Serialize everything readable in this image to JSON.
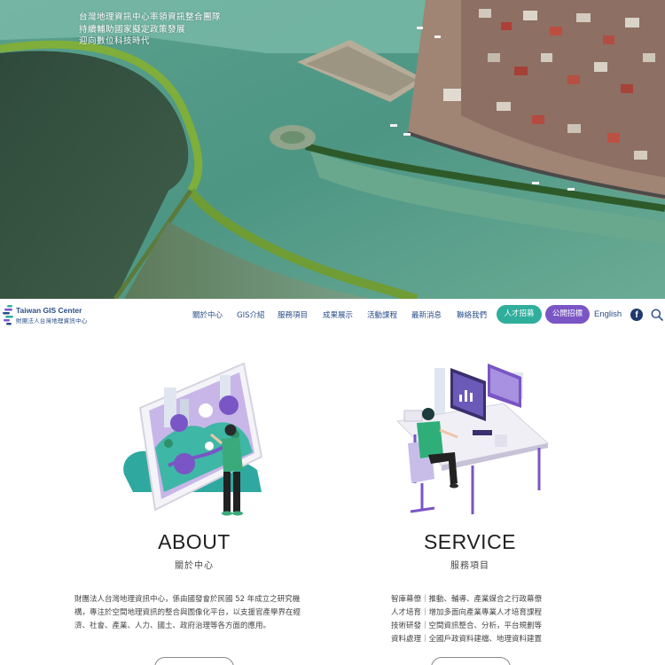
{
  "hero": {
    "lines": [
      "台灣地理資訊中心率領資訊整合團隊",
      "持續輔助國家擬定政策發展",
      "迎向數位科技時代"
    ],
    "colors": {
      "sea": "#3f7f73",
      "land": "#3a5a2c",
      "water": "#8fc4b4"
    }
  },
  "nav": {
    "logo": {
      "en": "Taiwan GIS Center",
      "zh": "財團法人台灣地理資訊中心"
    },
    "items": [
      "關於中心",
      "GIS介紹",
      "服務項目",
      "成果展示",
      "活動課程",
      "最新消息",
      "聯絡我們"
    ],
    "talent_label": "人才招募",
    "tender_label": "公開招標",
    "lang_label": "English",
    "facebook_icon": "facebook-icon",
    "search_icon": "search-icon",
    "colors": {
      "text": "#2a4e8a",
      "talent": "#2fae9c",
      "tender": "#7a55c6"
    }
  },
  "about": {
    "title": "ABOUT",
    "subtitle": "關於中心",
    "body": "財團法人台灣地理資訊中心，係由國發會於民國 52 年成立之研究機構，專注於空間地理資訊的整合與圖像化平台，以支援官產學界在經濟、社會、產業、人力、國土、政府治理等各方面的應用。"
  },
  "service": {
    "title": "SERVICE",
    "subtitle": "服務項目",
    "lines": [
      "智庫幕僚｜推動、輔導、產業媒合之行政幕僚",
      "人才培育｜增加多面向產業專業人才培育課程",
      "技術研發｜空間資訊整合、分析，平台規劃等",
      "資料處理｜全國戶政資料建檔、地理資料建置"
    ]
  }
}
